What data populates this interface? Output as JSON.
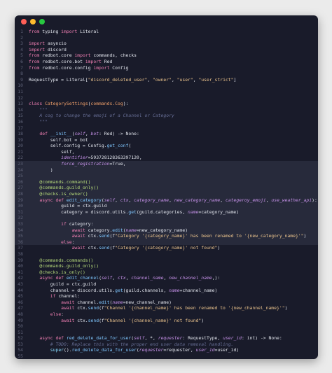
{
  "window": {
    "controls": [
      "close",
      "minimize",
      "maximize"
    ]
  },
  "colors": {
    "background": "#ebebeb",
    "editor_bg": "#191b2a",
    "line_number": "#5e6277",
    "keyword": "#f07fb3",
    "string": "#ecc48d",
    "function": "#7fc7ff",
    "class": "#f0a06a",
    "parameter": "#c792ea",
    "decorator": "#b5d97a",
    "comment": "#676e95"
  },
  "code": {
    "highlighted_lines": [
      23,
      24,
      25,
      26,
      27,
      28,
      29,
      30,
      31,
      32,
      33,
      34,
      35,
      36
    ],
    "lines": [
      [
        {
          "t": "from",
          "c": "kw"
        },
        {
          "t": " typing "
        },
        {
          "t": "import",
          "c": "kw"
        },
        {
          "t": " Literal"
        }
      ],
      [],
      [
        {
          "t": "import",
          "c": "kw"
        },
        {
          "t": " asyncio"
        }
      ],
      [
        {
          "t": "import",
          "c": "kw"
        },
        {
          "t": " discord"
        }
      ],
      [
        {
          "t": "from",
          "c": "kw"
        },
        {
          "t": " redbot.core "
        },
        {
          "t": "import",
          "c": "kw"
        },
        {
          "t": " commands, checks"
        }
      ],
      [
        {
          "t": "from",
          "c": "kw"
        },
        {
          "t": " redbot.core.bot "
        },
        {
          "t": "import",
          "c": "kw"
        },
        {
          "t": " Red"
        }
      ],
      [
        {
          "t": "from",
          "c": "kw"
        },
        {
          "t": " redbot.core.config "
        },
        {
          "t": "import",
          "c": "kw"
        },
        {
          "t": " Config"
        }
      ],
      [],
      [
        {
          "t": "RequestType = Literal["
        },
        {
          "t": "\"discord_deleted_user\"",
          "c": "st"
        },
        {
          "t": ", "
        },
        {
          "t": "\"owner\"",
          "c": "st"
        },
        {
          "t": ", "
        },
        {
          "t": "\"user\"",
          "c": "st"
        },
        {
          "t": ", "
        },
        {
          "t": "\"user_strict\"",
          "c": "st"
        },
        {
          "t": "]"
        }
      ],
      [],
      [],
      [],
      [
        {
          "t": "class",
          "c": "kw"
        },
        {
          "t": " "
        },
        {
          "t": "CategorySettings",
          "c": "cl"
        },
        {
          "t": "("
        },
        {
          "t": "commands.Cog",
          "c": "cl"
        },
        {
          "t": "):"
        }
      ],
      [
        {
          "t": "    \"\"\"",
          "c": "cm"
        }
      ],
      [
        {
          "t": "    A cog to change the emoji of a Channel or Category",
          "c": "cm"
        }
      ],
      [
        {
          "t": "    \"\"\"",
          "c": "cm"
        }
      ],
      [],
      [
        {
          "t": "    "
        },
        {
          "t": "def",
          "c": "kw"
        },
        {
          "t": " "
        },
        {
          "t": "__init__",
          "c": "fn"
        },
        {
          "t": "("
        },
        {
          "t": "self",
          "c": "pa"
        },
        {
          "t": ", "
        },
        {
          "t": "bot",
          "c": "pa"
        },
        {
          "t": ": Red) -> None:"
        }
      ],
      [
        {
          "t": "        self.bot = bot"
        }
      ],
      [
        {
          "t": "        self.config = Config."
        },
        {
          "t": "get_conf",
          "c": "fn"
        },
        {
          "t": "("
        }
      ],
      [
        {
          "t": "            self,"
        }
      ],
      [
        {
          "t": "            "
        },
        {
          "t": "identifier",
          "c": "pa"
        },
        {
          "t": "=593728128363397120,"
        }
      ],
      [
        {
          "t": "            "
        },
        {
          "t": "force_registration",
          "c": "pa"
        },
        {
          "t": "=True,"
        }
      ],
      [
        {
          "t": "        )"
        }
      ],
      [],
      [
        {
          "t": "    "
        },
        {
          "t": "@commands.command()",
          "c": "dc"
        }
      ],
      [
        {
          "t": "    "
        },
        {
          "t": "@commands.guild_only()",
          "c": "dc"
        }
      ],
      [
        {
          "t": "    "
        },
        {
          "t": "@checks.is_owner()",
          "c": "dc"
        }
      ],
      [
        {
          "t": "    "
        },
        {
          "t": "async def",
          "c": "kw"
        },
        {
          "t": " "
        },
        {
          "t": "edit_category",
          "c": "fn"
        },
        {
          "t": "("
        },
        {
          "t": "self",
          "c": "pa"
        },
        {
          "t": ", "
        },
        {
          "t": "ctx",
          "c": "pa"
        },
        {
          "t": ", "
        },
        {
          "t": "category_name",
          "c": "pa"
        },
        {
          "t": ", "
        },
        {
          "t": "new_category_name",
          "c": "pa"
        },
        {
          "t": ", "
        },
        {
          "t": "categeroy_emoji",
          "c": "pa"
        },
        {
          "t": ", "
        },
        {
          "t": "use_weather_api",
          "c": "pa"
        },
        {
          "t": "):"
        }
      ],
      [
        {
          "t": "            guild = ctx.guild"
        }
      ],
      [
        {
          "t": "            category = discord.utils."
        },
        {
          "t": "get",
          "c": "fn"
        },
        {
          "t": "(guild.categories, "
        },
        {
          "t": "name",
          "c": "pa"
        },
        {
          "t": "=category_name)"
        }
      ],
      [],
      [
        {
          "t": "            "
        },
        {
          "t": "if",
          "c": "kw"
        },
        {
          "t": " category:"
        }
      ],
      [
        {
          "t": "                "
        },
        {
          "t": "await",
          "c": "kw"
        },
        {
          "t": " category."
        },
        {
          "t": "edit",
          "c": "fn"
        },
        {
          "t": "("
        },
        {
          "t": "name",
          "c": "pa"
        },
        {
          "t": "=new_category_name)"
        }
      ],
      [
        {
          "t": "                "
        },
        {
          "t": "await",
          "c": "kw"
        },
        {
          "t": " ctx."
        },
        {
          "t": "send",
          "c": "fn"
        },
        {
          "t": "(f"
        },
        {
          "t": "\"Category '{category_name}' has been renamed to '{new_category_name}'\"",
          "c": "st"
        },
        {
          "t": ")"
        }
      ],
      [
        {
          "t": "            "
        },
        {
          "t": "else",
          "c": "kw"
        },
        {
          "t": ":"
        }
      ],
      [
        {
          "t": "                "
        },
        {
          "t": "await",
          "c": "kw"
        },
        {
          "t": " ctx."
        },
        {
          "t": "send",
          "c": "fn"
        },
        {
          "t": "(f"
        },
        {
          "t": "\"Category '{category_name}' not found\"",
          "c": "st"
        },
        {
          "t": ")"
        }
      ],
      [],
      [
        {
          "t": "    "
        },
        {
          "t": "@commands.commands()",
          "c": "dc"
        }
      ],
      [
        {
          "t": "    "
        },
        {
          "t": "@commands.guild_only()",
          "c": "dc"
        }
      ],
      [
        {
          "t": "    "
        },
        {
          "t": "@checks.is_only()",
          "c": "dc"
        }
      ],
      [
        {
          "t": "    "
        },
        {
          "t": "async def",
          "c": "kw"
        },
        {
          "t": " "
        },
        {
          "t": "edit_channel",
          "c": "fn"
        },
        {
          "t": "("
        },
        {
          "t": "self",
          "c": "pa"
        },
        {
          "t": ", "
        },
        {
          "t": "ctx",
          "c": "pa"
        },
        {
          "t": ", "
        },
        {
          "t": "channel_name",
          "c": "pa"
        },
        {
          "t": ", "
        },
        {
          "t": "new_channel_name",
          "c": "pa"
        },
        {
          "t": ",):"
        }
      ],
      [
        {
          "t": "        guild = ctx.guild"
        }
      ],
      [
        {
          "t": "        channel = discord.utils."
        },
        {
          "t": "get",
          "c": "fn"
        },
        {
          "t": "(guild.channels, "
        },
        {
          "t": "name",
          "c": "pa"
        },
        {
          "t": "=channel_name)"
        }
      ],
      [
        {
          "t": "        "
        },
        {
          "t": "if",
          "c": "kw"
        },
        {
          "t": " channel:"
        }
      ],
      [
        {
          "t": "            "
        },
        {
          "t": "await",
          "c": "kw"
        },
        {
          "t": " channel."
        },
        {
          "t": "edit",
          "c": "fn"
        },
        {
          "t": "("
        },
        {
          "t": "name",
          "c": "pa"
        },
        {
          "t": "=new_channel_name)"
        }
      ],
      [
        {
          "t": "            "
        },
        {
          "t": "await",
          "c": "kw"
        },
        {
          "t": " ctx."
        },
        {
          "t": "send",
          "c": "fn"
        },
        {
          "t": "(f"
        },
        {
          "t": "\"Channel '{channel_name}' has been renamed to '{new_channel_name}'\"",
          "c": "st"
        },
        {
          "t": ")"
        }
      ],
      [
        {
          "t": "        "
        },
        {
          "t": "else",
          "c": "kw"
        },
        {
          "t": ":"
        }
      ],
      [
        {
          "t": "            "
        },
        {
          "t": "await",
          "c": "kw"
        },
        {
          "t": " ctx."
        },
        {
          "t": "send",
          "c": "fn"
        },
        {
          "t": "(f"
        },
        {
          "t": "\"Channel '{channel_name}' not found\"",
          "c": "st"
        },
        {
          "t": ")"
        }
      ],
      [],
      [],
      [
        {
          "t": "    "
        },
        {
          "t": "async def",
          "c": "kw"
        },
        {
          "t": " "
        },
        {
          "t": "red_delete_data_for_user",
          "c": "fn"
        },
        {
          "t": "("
        },
        {
          "t": "self",
          "c": "pa"
        },
        {
          "t": ", *, "
        },
        {
          "t": "requester",
          "c": "pa"
        },
        {
          "t": ": RequestType, "
        },
        {
          "t": "user_id",
          "c": "pa"
        },
        {
          "t": ": int) -> None:"
        }
      ],
      [
        {
          "t": "        # TODO: Replace this with the proper end user data removal handling.",
          "c": "cm"
        }
      ],
      [
        {
          "t": "        "
        },
        {
          "t": "super",
          "c": "bi"
        },
        {
          "t": "()."
        },
        {
          "t": "red_delete_data_for_user",
          "c": "fn"
        },
        {
          "t": "("
        },
        {
          "t": "requester",
          "c": "pa"
        },
        {
          "t": "=requester, "
        },
        {
          "t": "user_id",
          "c": "pa"
        },
        {
          "t": "=user_id)"
        }
      ],
      []
    ]
  }
}
